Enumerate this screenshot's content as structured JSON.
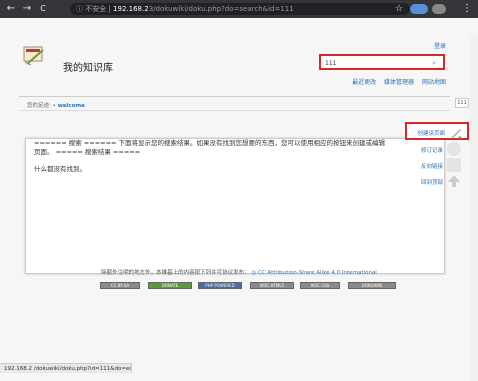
{
  "browser": {
    "back_icon": "←",
    "forward_icon": "→",
    "reload_icon": "C",
    "warn_text": "ⓘ 不安全 | ",
    "url_host": "192.168.2",
    "url_path": "3/dokuwiki/doku.php?do=search&id=111",
    "star_icon": "☆",
    "menu_icon": "⋮"
  },
  "header": {
    "site_title": "我的知识库",
    "login_label": "登录",
    "search_value": "111",
    "search_icon": "🔍",
    "tools": [
      "最近更改",
      "媒体管理器",
      "网站地图"
    ]
  },
  "trace": {
    "label": "您的足迹:",
    "bullet": "•",
    "link": "welcome"
  },
  "content": {
    "line1": "====== 搜索 ====== 下面将显示您的搜索结果。如果没有找到您想要的东西，您可以使用相应的按钮来创建或编辑",
    "line2": "页面。 ===== 搜索结果 =====",
    "line3": "什么都没有找到。"
  },
  "page_id": "111",
  "pagetools": {
    "create": "创建该页面",
    "revisions": "修订记录",
    "backlinks": "反向链接",
    "top": "回到顶部"
  },
  "footer": {
    "text": "除额外注明的地方外，本维基上的内容按下列许可协议发布：",
    "license": "CC Attribution-Share Alike 4.0 International",
    "badges": [
      "CC BY-SA",
      "DONATE",
      "PHP POWERED",
      "W3C HTML5",
      "W3C CSS",
      "DOKUWIKI"
    ]
  },
  "status_bar": "192.168.2 /dokuwiki/doku.php?id=111&do=edit",
  "colors": {
    "highlight": "#d9262c",
    "link": "#2b73b7"
  }
}
